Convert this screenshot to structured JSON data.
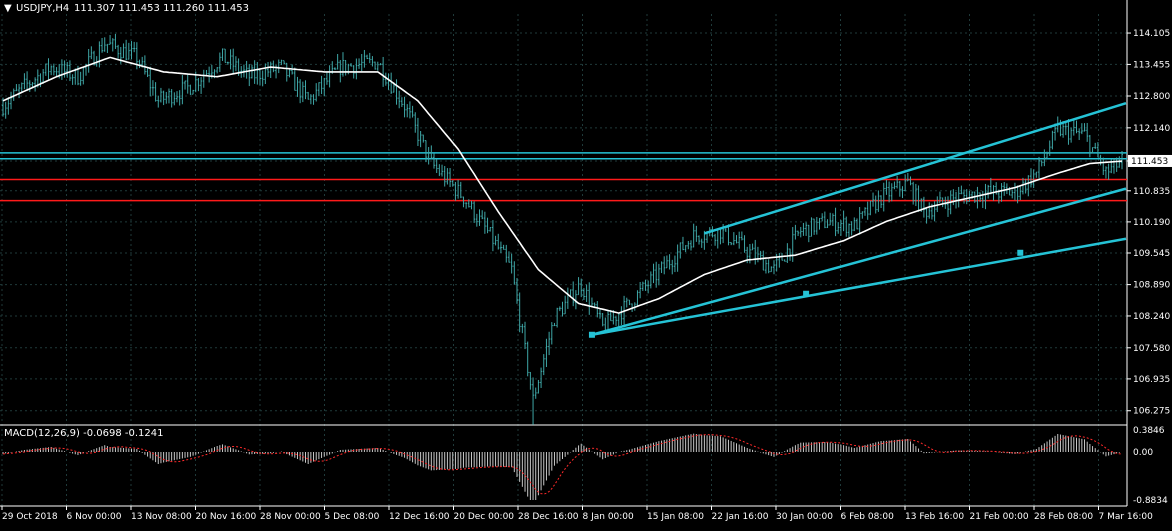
{
  "header": {
    "symbol_label": "USDJPY,H4",
    "ohlc_label": "111.307 111.453 111.260 111.453"
  },
  "macd": {
    "label": "MACD(12,26,9) -0.0698 -0.1241",
    "axis_labels": [
      "0.3846",
      "0.00",
      "-0.8834"
    ]
  },
  "colors": {
    "background": "#000000",
    "grid": "#1f3a3a",
    "bar_up": "#3fa7a7",
    "bar_down": "#3fa7a7",
    "moving_average": "#ffffff",
    "trendline": "#25c3d6",
    "horizontal_cyan": "#25c3d6",
    "horizontal_red": "#ff1a1a",
    "axis_text": "#ffffff",
    "macd_signal": "#ff2a2a",
    "macd_hist": "#c8c8c8"
  },
  "chart_data": {
    "type": "candlestick",
    "title": "USDJPY,H4",
    "ylim": [
      106.0,
      114.5
    ],
    "y_ticks": [
      "114.105",
      "113.455",
      "112.800",
      "112.140",
      "111.453",
      "110.835",
      "110.190",
      "109.545",
      "108.890",
      "108.240",
      "107.580",
      "106.935",
      "106.275"
    ],
    "price_tag": "111.453",
    "x_ticks": [
      "29 Oct 2018",
      "6 Nov 00:00",
      "13 Nov 08:00",
      "20 Nov 16:00",
      "28 Nov 00:00",
      "5 Dec 08:00",
      "12 Dec 16:00",
      "20 Dec 00:00",
      "28 Dec 16:00",
      "8 Jan 00:00",
      "15 Jan 08:00",
      "22 Jan 16:00",
      "30 Jan 00:00",
      "6 Feb 08:00",
      "13 Feb 16:00",
      "21 Feb 00:00",
      "28 Feb 08:00",
      "7 Mar 16:00"
    ],
    "close_anchors": [
      [
        0,
        112.6
      ],
      [
        8,
        113.0
      ],
      [
        18,
        113.4
      ],
      [
        28,
        113.2
      ],
      [
        38,
        113.9
      ],
      [
        50,
        113.6
      ],
      [
        58,
        112.7
      ],
      [
        70,
        113.0
      ],
      [
        82,
        113.6
      ],
      [
        92,
        113.2
      ],
      [
        104,
        113.4
      ],
      [
        114,
        112.7
      ],
      [
        126,
        113.4
      ],
      [
        140,
        113.5
      ],
      [
        150,
        112.6
      ],
      [
        160,
        111.4
      ],
      [
        172,
        110.7
      ],
      [
        182,
        109.9
      ],
      [
        190,
        109.2
      ],
      [
        198,
        106.5
      ],
      [
        206,
        108.2
      ],
      [
        216,
        108.9
      ],
      [
        224,
        108.0
      ],
      [
        234,
        108.5
      ],
      [
        246,
        109.2
      ],
      [
        258,
        109.9
      ],
      [
        268,
        110.0
      ],
      [
        278,
        109.6
      ],
      [
        288,
        109.2
      ],
      [
        298,
        110.0
      ],
      [
        308,
        110.2
      ],
      [
        318,
        110.1
      ],
      [
        328,
        110.7
      ],
      [
        338,
        111.0
      ],
      [
        344,
        110.4
      ],
      [
        356,
        110.7
      ],
      [
        368,
        110.8
      ],
      [
        378,
        110.8
      ],
      [
        386,
        111.2
      ],
      [
        394,
        112.1
      ],
      [
        404,
        112.0
      ],
      [
        412,
        111.2
      ],
      [
        418,
        111.453
      ]
    ],
    "ma_anchors": [
      [
        0,
        112.7
      ],
      [
        20,
        113.2
      ],
      [
        40,
        113.6
      ],
      [
        60,
        113.3
      ],
      [
        80,
        113.2
      ],
      [
        100,
        113.4
      ],
      [
        120,
        113.3
      ],
      [
        140,
        113.3
      ],
      [
        155,
        112.7
      ],
      [
        170,
        111.7
      ],
      [
        185,
        110.4
      ],
      [
        200,
        109.2
      ],
      [
        215,
        108.5
      ],
      [
        230,
        108.3
      ],
      [
        245,
        108.6
      ],
      [
        262,
        109.1
      ],
      [
        278,
        109.4
      ],
      [
        296,
        109.5
      ],
      [
        314,
        109.8
      ],
      [
        330,
        110.2
      ],
      [
        346,
        110.5
      ],
      [
        362,
        110.7
      ],
      [
        378,
        110.9
      ],
      [
        394,
        111.2
      ],
      [
        406,
        111.4
      ],
      [
        418,
        111.45
      ]
    ],
    "horizontal_lines": [
      {
        "price": 111.62,
        "color": "cyan"
      },
      {
        "price": 111.5,
        "color": "cyan"
      },
      {
        "price": 111.07,
        "color": "red"
      },
      {
        "price": 110.63,
        "color": "red"
      }
    ],
    "trendlines": [
      {
        "from": [
          262,
          109.95
        ],
        "to": [
          418,
          112.65
        ]
      },
      {
        "from": [
          220,
          107.85
        ],
        "to": [
          418,
          110.88
        ]
      },
      {
        "from": [
          220,
          107.85
        ],
        "to": [
          418,
          109.84
        ]
      }
    ],
    "trend_markers": [
      {
        "at": [
          220,
          107.85
        ]
      },
      {
        "at": [
          300,
          108.7
        ]
      },
      {
        "at": [
          380,
          109.55
        ]
      }
    ],
    "bar_count": 419
  }
}
